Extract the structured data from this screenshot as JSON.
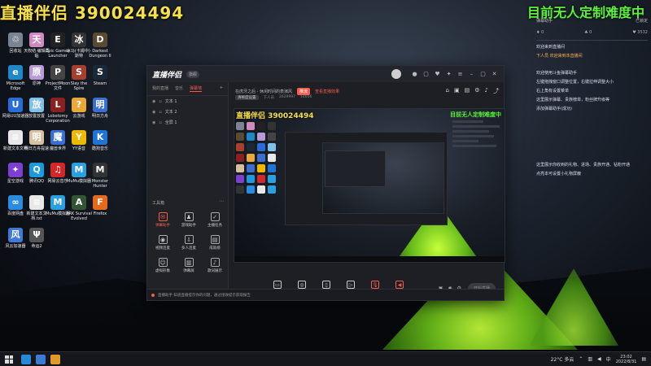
{
  "overlay": {
    "stream_id": "直播伴侣 390024494",
    "difficulty": "目前无人定制难度中"
  },
  "desktop_icons": [
    {
      "label": "回收站",
      "color": "#7a8391",
      "glyph": "♲"
    },
    {
      "label": "天权结·编辑再临",
      "color": "#d08ac0",
      "glyph": "天"
    },
    {
      "label": "Epic Games Launcher",
      "color": "#222222",
      "glyph": "E"
    },
    {
      "label": "冰马(卡姆中)·斯特",
      "color": "#333333",
      "glyph": "冰"
    },
    {
      "label": "Darkest Dungeon II",
      "color": "#5a4a30",
      "glyph": "D"
    },
    {
      "label": "Microsoft Edge",
      "color": "#1e88c9",
      "glyph": "e"
    },
    {
      "label": "原神",
      "color": "#b89bd6",
      "glyph": "原"
    },
    {
      "label": "ProjectMoon 文件",
      "color": "#444444",
      "glyph": "P"
    },
    {
      "label": "Slay the Spire",
      "color": "#a5402e",
      "glyph": "S"
    },
    {
      "label": "Steam",
      "color": "#1b2838",
      "glyph": "S"
    },
    {
      "label": "网易UU加速器",
      "color": "#2a6cd6",
      "glyph": "U"
    },
    {
      "label": "放置放置",
      "color": "#7fc0e8",
      "glyph": "放"
    },
    {
      "label": "Lobotomy Corporation",
      "color": "#8a2020",
      "glyph": "L"
    },
    {
      "label": "云游戏",
      "color": "#e8a93a",
      "glyph": "?"
    },
    {
      "label": "明日方舟",
      "color": "#3a6fd0",
      "glyph": "明"
    },
    {
      "label": "新建文本文档",
      "color": "#e8e8e8",
      "glyph": "≡"
    },
    {
      "label": "明日方舟提速",
      "color": "#d5c0a0",
      "glyph": "明"
    },
    {
      "label": "魔兽世界",
      "color": "#3a6fd0",
      "glyph": "魔"
    },
    {
      "label": "YY语音",
      "color": "#f0b800",
      "glyph": "Y"
    },
    {
      "label": "酷狗音乐",
      "color": "#1f74d6",
      "glyph": "K"
    },
    {
      "label": "星空游戏",
      "color": "#7c3fd0",
      "glyph": "✦"
    },
    {
      "label": "腾讯QQ",
      "color": "#1b9ae0",
      "glyph": "Q"
    },
    {
      "label": "网易云音乐",
      "color": "#d3282a",
      "glyph": "♫"
    },
    {
      "label": "MuMu模拟器",
      "color": "#2aa0e0",
      "glyph": "M"
    },
    {
      "label": "Monster Hunter",
      "color": "#333333",
      "glyph": "M"
    },
    {
      "label": "百度网盘",
      "color": "#2a8ce0",
      "glyph": "∞"
    },
    {
      "label": "新建文本文档.txt",
      "color": "#e8e8e8",
      "glyph": "≡"
    },
    {
      "label": "MuMu模拟器",
      "color": "#2aa0e0",
      "glyph": "M"
    },
    {
      "label": "ARK Survival Evolved",
      "color": "#335533",
      "glyph": "A"
    },
    {
      "label": "Firefox",
      "color": "#e66a1a",
      "glyph": "F"
    },
    {
      "label": "风云加速器",
      "color": "#3e7ad6",
      "glyph": "风"
    },
    {
      "label": "命运2",
      "color": "#555555",
      "glyph": "Ψ"
    }
  ],
  "chat": {
    "header_left": "弹幕助手",
    "header_right": "已锁定",
    "stats": [
      "0",
      "0",
      "3532"
    ],
    "lines": [
      {
        "text": "欢迎来到直播间",
        "cls": ""
      },
      {
        "text": "下人员 欢迎来到本直播间",
        "cls": "hl"
      },
      {
        "text": "欢迎使用斗鱼弹幕助手",
        "cls": ""
      },
      {
        "text": "左键拖拽窗口调整位置，右键拉伸调整大小",
        "cls": ""
      },
      {
        "text": "右上角有设置菜单",
        "cls": ""
      },
      {
        "text": "这里展示弹幕、贵族榜单，粉丝牌升级等",
        "cls": ""
      },
      {
        "text": "添加弹幕助手(成功)",
        "cls": ""
      },
      {
        "text": "这里展示你收到的礼物、进场、贵族开通、钻粉开通",
        "cls": ""
      },
      {
        "text": "点亮本可设置小礼物屏蔽",
        "cls": ""
      }
    ]
  },
  "app": {
    "title": "直播伴侣",
    "title_badge": "旗舰",
    "tabs": [
      "我的直播",
      "音乐",
      "弹幕墙"
    ],
    "active_tab_index": 2,
    "scenes": [
      "文本 1",
      "文本 2",
      "全屏 1"
    ],
    "tools_title": "工具箱",
    "tools": [
      {
        "label": "弹幕助手",
        "glyph": "✉",
        "red": true
      },
      {
        "label": "游戏助手",
        "glyph": "♟",
        "red": false
      },
      {
        "label": "主播任务",
        "glyph": "✓",
        "red": false
      },
      {
        "label": "视频连麦",
        "glyph": "◉",
        "red": false
      },
      {
        "label": "多人连麦",
        "glyph": "⇩",
        "red": false
      },
      {
        "label": "成就榜",
        "glyph": "▤",
        "red": false
      },
      {
        "label": "虚拟形象",
        "glyph": "☺",
        "red": false
      },
      {
        "label": "弹幕屏",
        "glyph": "▥",
        "red": false
      },
      {
        "label": "歌词展示",
        "glyph": "♪",
        "red": false
      }
    ],
    "stream_title": "在虎牙之后 - 休闲时间的表演风",
    "stream_tag": "推流",
    "stream_link": "查看直播效果",
    "sub_chip": "清晰度设置",
    "sub_1": "下人员",
    "sub_2": "2629997",
    "sub_3": "14656",
    "controls": [
      {
        "label": "直播屏幕",
        "glyph": "▭",
        "red": false
      },
      {
        "label": "摄像头",
        "glyph": "◎",
        "red": false
      },
      {
        "label": "手机投屏",
        "glyph": "▯",
        "red": false
      },
      {
        "label": "多媒体",
        "glyph": "▷",
        "red": false
      },
      {
        "label": "麦克风",
        "glyph": "🎙",
        "red": true
      },
      {
        "label": "扬声器",
        "glyph": "◀",
        "red": true
      }
    ],
    "start_label": "开始直播",
    "status_text": "直播助手 知道直播提示你的问题，通过接收提示获取报告",
    "preview_id": "直播伴侣 390024494",
    "preview_diff": "目前无人定制难度中"
  },
  "taskbar": {
    "weather": "22°C 多云",
    "time": "23:02",
    "date": "2022/8/31"
  }
}
